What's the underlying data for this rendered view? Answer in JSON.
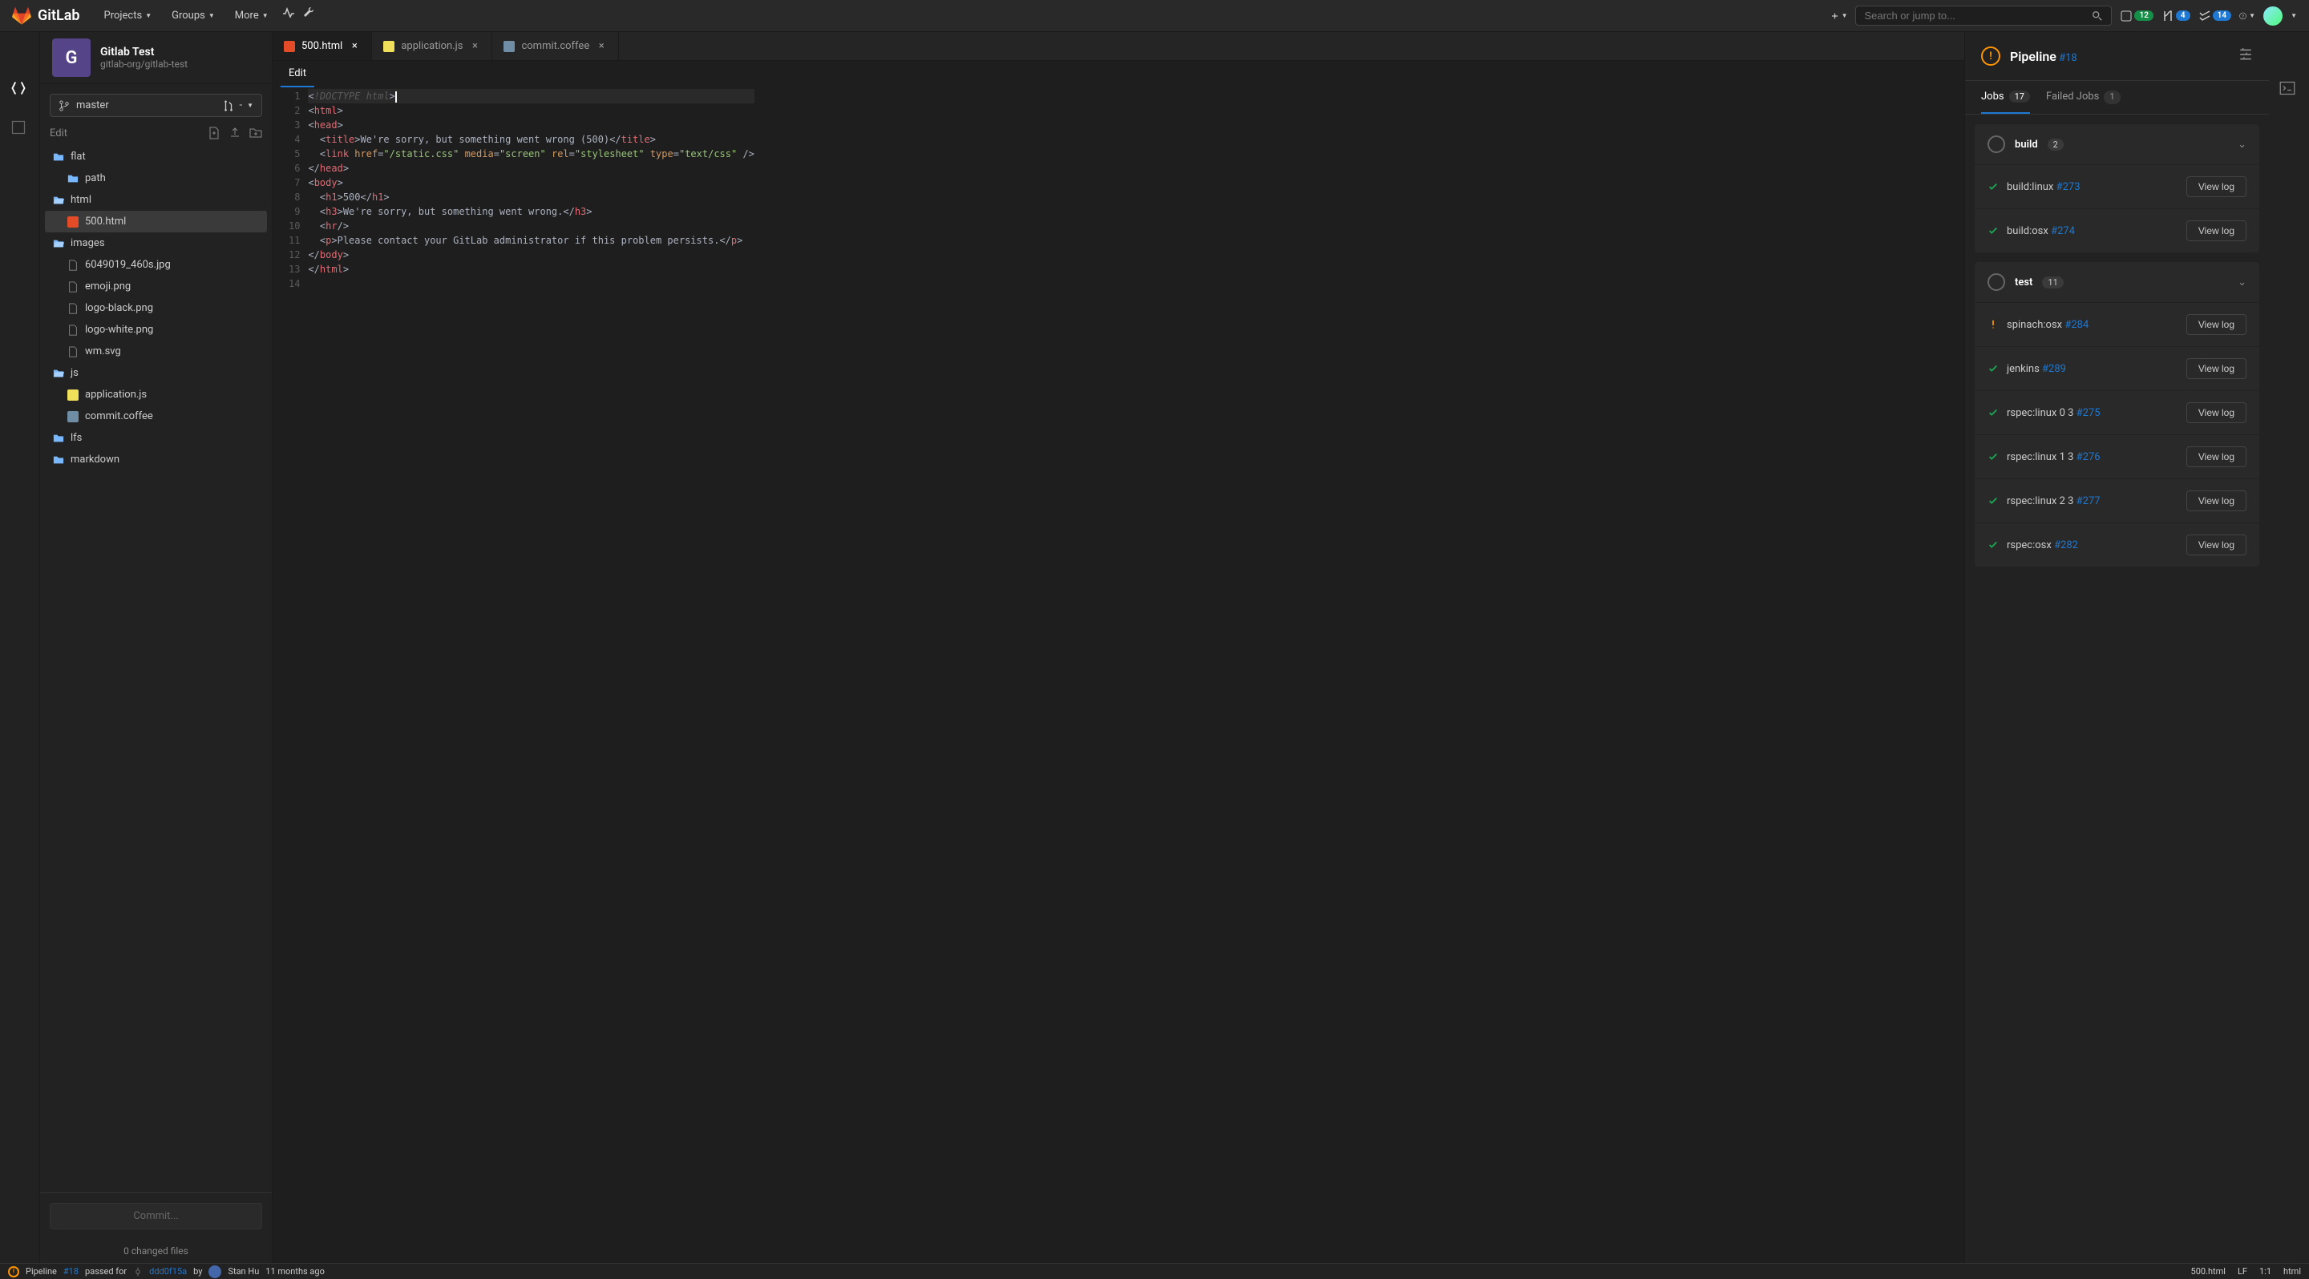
{
  "nav": {
    "brand": "GitLab",
    "projects": "Projects",
    "groups": "Groups",
    "more": "More",
    "search_placeholder": "Search or jump to...",
    "badge_mr": "12",
    "badge_todo": "4",
    "badge_issues": "14"
  },
  "project": {
    "avatar_letter": "G",
    "name": "Gitlab Test",
    "path": "gitlab-org/gitlab-test"
  },
  "branch": {
    "name": "master",
    "mr_dash": "-"
  },
  "sidebar": {
    "edit_label": "Edit"
  },
  "tree": [
    {
      "type": "folder",
      "name": "flat",
      "depth": 0
    },
    {
      "type": "folder",
      "name": "path",
      "depth": 1,
      "small": true
    },
    {
      "type": "folder",
      "name": "html",
      "depth": 0,
      "open": true
    },
    {
      "type": "file",
      "name": "500.html",
      "depth": 1,
      "icon": "html",
      "active": true
    },
    {
      "type": "folder",
      "name": "images",
      "depth": 0,
      "open": true
    },
    {
      "type": "file",
      "name": "6049019_460s.jpg",
      "depth": 1
    },
    {
      "type": "file",
      "name": "emoji.png",
      "depth": 1
    },
    {
      "type": "file",
      "name": "logo-black.png",
      "depth": 1
    },
    {
      "type": "file",
      "name": "logo-white.png",
      "depth": 1
    },
    {
      "type": "file",
      "name": "wm.svg",
      "depth": 1
    },
    {
      "type": "folder",
      "name": "js",
      "depth": 0,
      "open": true
    },
    {
      "type": "file",
      "name": "application.js",
      "depth": 1,
      "icon": "js"
    },
    {
      "type": "file",
      "name": "commit.coffee",
      "depth": 1,
      "icon": "coffee"
    },
    {
      "type": "folder",
      "name": "lfs",
      "depth": 0
    },
    {
      "type": "folder",
      "name": "markdown",
      "depth": 0
    }
  ],
  "commit_btn": "Commit...",
  "changed_files": "0 changed files",
  "tabs": [
    {
      "name": "500.html",
      "icon": "html",
      "active": true
    },
    {
      "name": "application.js",
      "icon": "js"
    },
    {
      "name": "commit.coffee",
      "icon": "coffee"
    }
  ],
  "editor_tab": "Edit",
  "code": {
    "lines": 14,
    "l1": "<!DOCTYPE html>",
    "l4_text": "We're sorry, but something went wrong (500)",
    "l5_href": "/static.css",
    "l5_media": "screen",
    "l5_rel": "stylesheet",
    "l5_type": "text/css",
    "l8_text": "500",
    "l9_text": "We're sorry, but something went wrong.",
    "l11_text": "Please contact your GitLab administrator if this problem persists."
  },
  "pipeline": {
    "title": "Pipeline",
    "id": "#18",
    "tabs": {
      "jobs": "Jobs",
      "jobs_count": "17",
      "failed": "Failed Jobs",
      "failed_count": "1"
    },
    "stages": [
      {
        "name": "build",
        "count": "2",
        "jobs": [
          {
            "status": "success",
            "name": "build:linux",
            "id": "#273"
          },
          {
            "status": "success",
            "name": "build:osx",
            "id": "#274"
          }
        ]
      },
      {
        "name": "test",
        "count": "11",
        "jobs": [
          {
            "status": "warning",
            "name": "spinach:osx",
            "id": "#284"
          },
          {
            "status": "success",
            "name": "jenkins",
            "id": "#289"
          },
          {
            "status": "success",
            "name": "rspec:linux 0 3",
            "id": "#275"
          },
          {
            "status": "success",
            "name": "rspec:linux 1 3",
            "id": "#276"
          },
          {
            "status": "success",
            "name": "rspec:linux 2 3",
            "id": "#277"
          },
          {
            "status": "success",
            "name": "rspec:osx",
            "id": "#282"
          }
        ]
      }
    ],
    "view_log": "View log"
  },
  "status": {
    "pipeline_label": "Pipeline",
    "pipeline_id": "#18",
    "passed_for": "passed for",
    "commit_sha": "ddd0f15a",
    "by": "by",
    "author": "Stan Hu",
    "time": "11 months ago",
    "file": "500.html",
    "lf": "LF",
    "pos": "1:1",
    "lang": "html"
  }
}
